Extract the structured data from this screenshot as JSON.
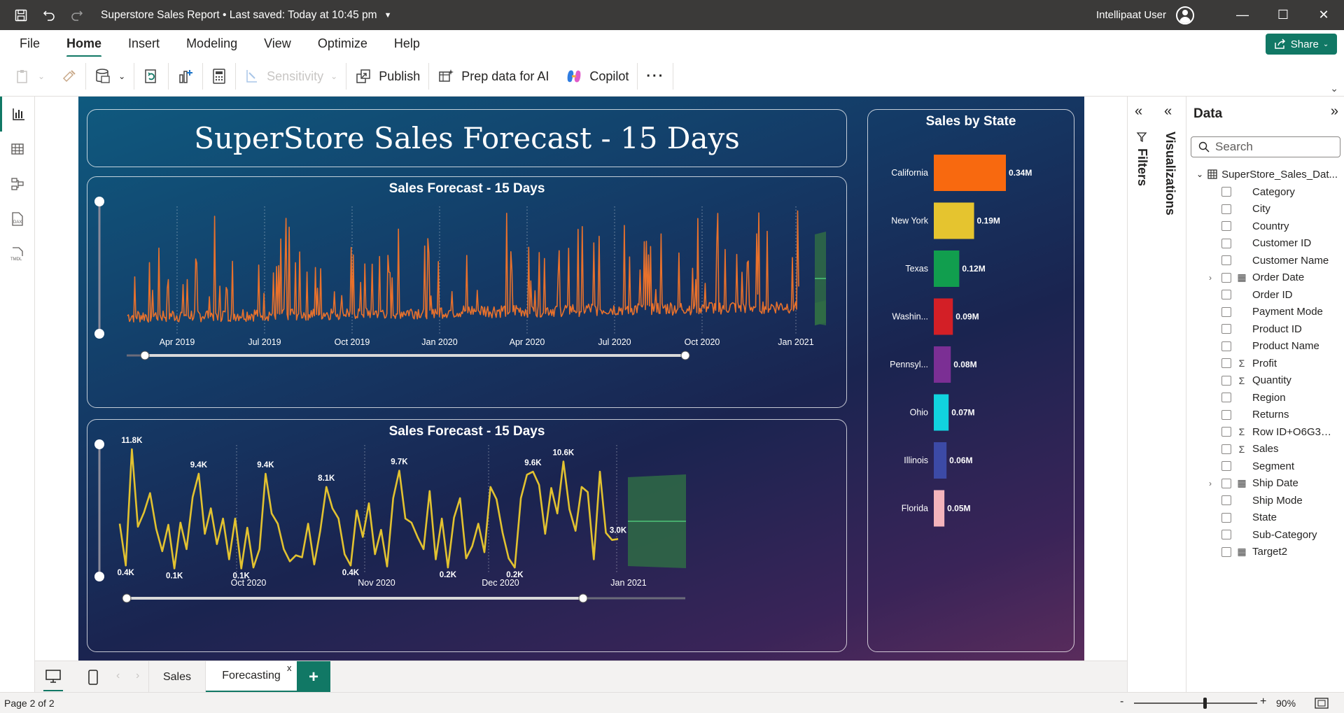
{
  "titlebar": {
    "doc_title": "Superstore Sales Report • Last saved: Today at 10:45 pm",
    "user": "Intellipaat User"
  },
  "menu": {
    "items": [
      "File",
      "Home",
      "Insert",
      "Modeling",
      "View",
      "Optimize",
      "Help"
    ],
    "active": "Home",
    "share_label": "Share"
  },
  "ribbon": {
    "sensitivity": "Sensitivity",
    "publish": "Publish",
    "prep_data": "Prep data for AI",
    "copilot": "Copilot",
    "more": "···"
  },
  "report": {
    "title": "SuperStore Sales Forecast - 15 Days",
    "chart1_title": "Sales Forecast - 15 Days",
    "chart2_title": "Sales Forecast - 15 Days",
    "state_title": "Sales by State"
  },
  "chart_data": [
    {
      "type": "line",
      "title": "Sales Forecast - 15 Days",
      "x_ticks": [
        "Apr 2019",
        "Jul 2019",
        "Oct 2019",
        "Jan 2020",
        "Apr 2020",
        "Jul 2020",
        "Oct 2020",
        "Jan 2021"
      ],
      "series": [
        {
          "values": []
        }
      ],
      "forecast": true,
      "colors": {
        "line": "#e8712c",
        "forecast": "#2f6b45"
      }
    },
    {
      "type": "line",
      "title": "Sales Forecast - 15 Days",
      "x_ticks": [
        "Oct 2020",
        "Nov 2020",
        "Dec 2020",
        "Jan 2021"
      ],
      "data_labels": [
        "11.8K",
        "0.4K",
        "0.1K",
        "9.4K",
        "0.1K",
        "9.4K",
        "8.1K",
        "0.4K",
        "9.7K",
        "0.2K",
        "0.2K",
        "9.6K",
        "10.6K",
        "3.0K"
      ],
      "series": [
        {
          "values": [
            4.5,
            0.4,
            11.8,
            4.2,
            5.6,
            7.5,
            4.0,
            1.8,
            4.4,
            0.1,
            4.6,
            2.0,
            7.1,
            9.4,
            3.5,
            6.0,
            2.5,
            5.0,
            1.0,
            5.0,
            0.1,
            4.1,
            0.2,
            2.0,
            9.4,
            5.5,
            4.5,
            2.0,
            0.8,
            1.4,
            1.2,
            4.5,
            0.5,
            3.8,
            8.1,
            6.0,
            5.0,
            1.5,
            0.4,
            5.8,
            3.2,
            6.5,
            1.5,
            3.9,
            0.3,
            7.0,
            9.7,
            5.0,
            4.6,
            3.2,
            2.0,
            7.7,
            1.0,
            5.0,
            0.2,
            5.1,
            7.0,
            1.1,
            2.3,
            4.5,
            1.7,
            8.1,
            6.9,
            3.6,
            1.1,
            0.2,
            7.0,
            9.3,
            9.6,
            8.3,
            3.5,
            8.0,
            5.5,
            10.6,
            5.9,
            3.8,
            8.1,
            7.6,
            1.0,
            9.6,
            3.6,
            2.9,
            3.0
          ]
        }
      ],
      "forecast": true,
      "colors": {
        "line": "#e2c230",
        "forecast": "#2f6b45"
      }
    },
    {
      "type": "bar",
      "title": "Sales by State",
      "categories": [
        "California",
        "New York",
        "Texas",
        "Washin...",
        "Pennsyl...",
        "Ohio",
        "Illinois",
        "Florida"
      ],
      "values": [
        0.34,
        0.19,
        0.12,
        0.09,
        0.08,
        0.07,
        0.06,
        0.05
      ],
      "labels": [
        "0.34M",
        "0.19M",
        "0.12M",
        "0.09M",
        "0.08M",
        "0.07M",
        "0.06M",
        "0.05M"
      ],
      "colors": [
        "#f8690f",
        "#e5c42f",
        "#119e4e",
        "#d31f26",
        "#7b2f94",
        "#11d3df",
        "#3c4aa6",
        "#f4b4bc"
      ]
    }
  ],
  "panes": {
    "filters": "Filters",
    "visualizations": "Visualizations",
    "data": "Data",
    "search_placeholder": "Search",
    "table": "SuperStore_Sales_Dat...",
    "fields": [
      {
        "label": "Category",
        "icon": ""
      },
      {
        "label": "City",
        "icon": ""
      },
      {
        "label": "Country",
        "icon": ""
      },
      {
        "label": "Customer ID",
        "icon": ""
      },
      {
        "label": "Customer Name",
        "icon": ""
      },
      {
        "label": "Order Date",
        "icon": "calendar",
        "expand": true
      },
      {
        "label": "Order ID",
        "icon": ""
      },
      {
        "label": "Payment Mode",
        "icon": ""
      },
      {
        "label": "Product ID",
        "icon": ""
      },
      {
        "label": "Product Name",
        "icon": ""
      },
      {
        "label": "Profit",
        "icon": "sigma"
      },
      {
        "label": "Quantity",
        "icon": "sigma"
      },
      {
        "label": "Region",
        "icon": ""
      },
      {
        "label": "Returns",
        "icon": ""
      },
      {
        "label": "Row ID+O6G3A...",
        "icon": "sigma"
      },
      {
        "label": "Sales",
        "icon": "sigma"
      },
      {
        "label": "Segment",
        "icon": ""
      },
      {
        "label": "Ship Date",
        "icon": "calendar",
        "expand": true
      },
      {
        "label": "Ship Mode",
        "icon": ""
      },
      {
        "label": "State",
        "icon": ""
      },
      {
        "label": "Sub-Category",
        "icon": ""
      },
      {
        "label": "Target2",
        "icon": "calculator"
      }
    ]
  },
  "pages": {
    "tabs": [
      "Sales",
      "Forecasting"
    ],
    "active": "Forecasting",
    "close": "x",
    "add": "+"
  },
  "status": {
    "page": "Page 2 of 2",
    "zoom": "90%",
    "minus": "-",
    "plus": "+"
  }
}
